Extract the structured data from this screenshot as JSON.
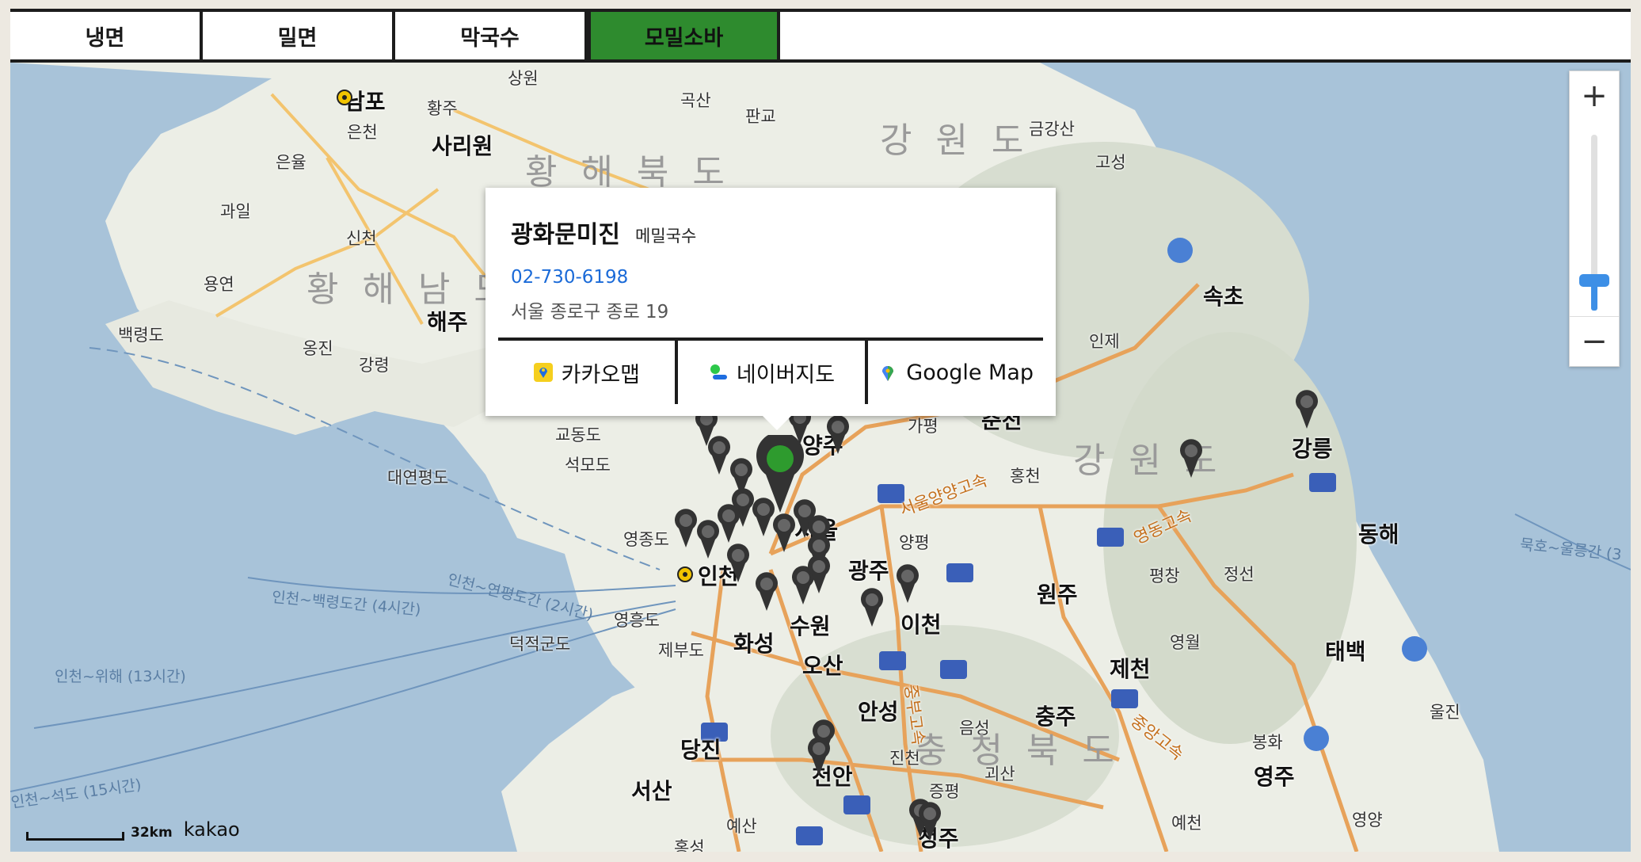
{
  "tabs": [
    {
      "label": "냉면"
    },
    {
      "label": "밀면"
    },
    {
      "label": "막국수"
    },
    {
      "label": "모밀소바"
    }
  ],
  "active_tab": "모밀소바",
  "colors": {
    "active_tab": "#2e8b2e",
    "phone": "#1a6ad8",
    "selected_marker": "#2e9b2e",
    "marker": "#333333"
  },
  "popup": {
    "name": "광화문미진",
    "category": "메밀국수",
    "phone": "02-730-6198",
    "address": "서울 종로구 종로 19",
    "links": [
      {
        "label": "카카오맵",
        "icon": "kakao-map-icon"
      },
      {
        "label": "네이버지도",
        "icon": "naver-map-icon"
      },
      {
        "label": "Google Map",
        "icon": "google-map-icon"
      }
    ]
  },
  "zoom": {
    "plus": "+",
    "minus": "−"
  },
  "scale": {
    "distance": "32km",
    "brand": "kakao"
  },
  "map_labels": {
    "nampo": "남포",
    "hwangju": "황주",
    "eunchon": "은천",
    "sariwon": "사리원",
    "eunyul": "은율",
    "gwail": "과일",
    "sinchon": "신천",
    "yongyeon": "용연",
    "haeju": "해주",
    "baengnyeongdo": "백령도",
    "ongjin": "옹진",
    "gangnyeong": "강령",
    "sangwon": "상원",
    "goksan": "곡산",
    "pangyo": "판교",
    "gimhwa": "금강산",
    "goseong": "고성",
    "hwanghaebukdo": "황 해 북 도",
    "hwanghaenamdo": "황 해 남 도",
    "gangwondo_n": "강 원 도",
    "gangwondo_s": "강 원 도",
    "sokcho": "속초",
    "inje": "인제",
    "chuncheon": "춘천",
    "gapyeong": "가평",
    "hongcheon": "홍천",
    "gangneung": "강릉",
    "donghae": "동해",
    "gyodongdo": "교동도",
    "seokmodo": "석모도",
    "daeyeonpyeongdo": "대연평도",
    "yeongjongdo": "영종도",
    "incheon": "인천",
    "seoul": "서울",
    "yangpyeong": "양평",
    "gwangju": "광주",
    "icheon": "이천",
    "wonju": "원주",
    "pyeongchang": "평창",
    "jeongseon": "정선",
    "yeongwol": "영월",
    "taebaek": "태백",
    "uljin": "울진",
    "jecheon": "제천",
    "chungju": "충주",
    "suwon": "수원",
    "osan": "오산",
    "hwaseong": "화성",
    "yeongheungdo": "영흥도",
    "deokjeokgundo": "덕적군도",
    "jebudo": "제부도",
    "anseong": "안성",
    "eumseong": "음성",
    "jincheon": "진천",
    "jeungpyeong": "증평",
    "goesan": "괴산",
    "chungcheongbukdo": "충 청 북 도",
    "cheonan": "천안",
    "dangjin": "당진",
    "seosan": "서산",
    "yesan": "예산",
    "hongseong": "홍성",
    "cheongju": "청주",
    "bonghwa": "봉화",
    "yeongju": "영주",
    "yecheon": "예천",
    "yeongyang": "영양",
    "yangju": "양주",
    "route_baengnyeong": "인천~백령도간 (4시간)",
    "route_yeonpyeong": "인천~연평도간 (2시간)",
    "route_wihae": "인천~위해 (13시간)",
    "route_seokdo": "인천~석도 (15시간)",
    "route_ulleung": "묵호~울릉간 (3",
    "hwy_seoulyangyang": "서울양양고속",
    "hwy_yeongdong": "영동고속",
    "hwy_jungbu": "중부고속",
    "hwy_jungang": "중앙고속"
  }
}
